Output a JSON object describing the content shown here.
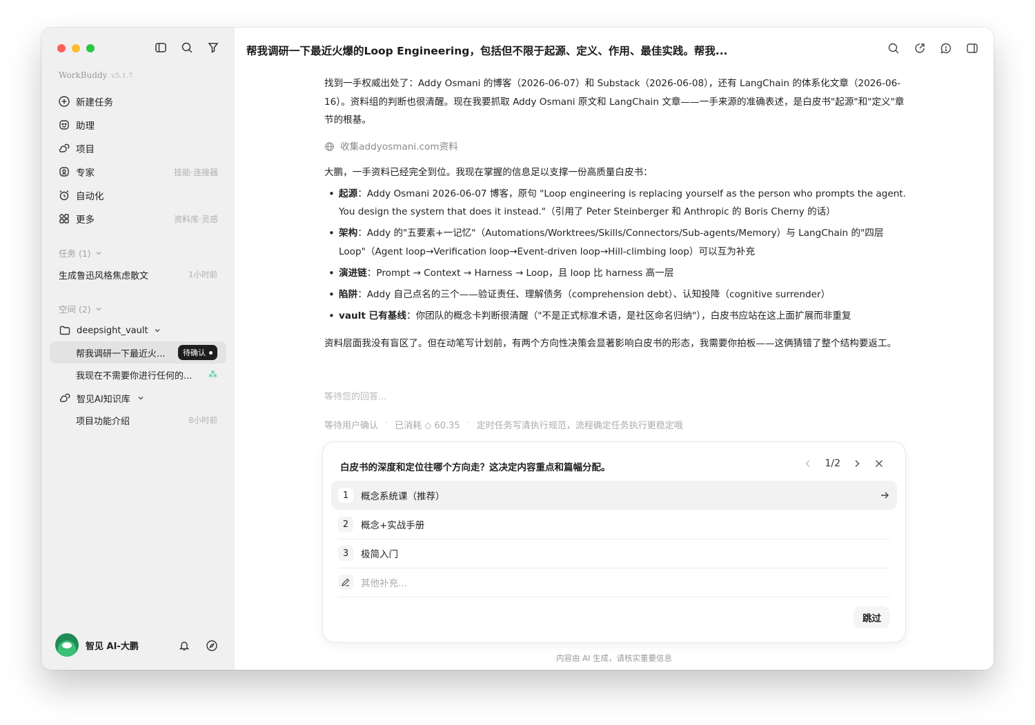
{
  "app": {
    "name": "WorkBuddy",
    "version": "v5.1.7"
  },
  "sidebar": {
    "nav": [
      {
        "label": "新建任务",
        "hint": "",
        "icon": "plus-circle-icon"
      },
      {
        "label": "助理",
        "hint": "",
        "icon": "assistant-icon"
      },
      {
        "label": "项目",
        "hint": "",
        "icon": "project-icon"
      },
      {
        "label": "专家",
        "hint": "技能·连接器",
        "icon": "expert-icon"
      },
      {
        "label": "自动化",
        "hint": "",
        "icon": "alarm-clock-icon"
      },
      {
        "label": "更多",
        "hint": "资料库·灵感",
        "icon": "grid-icon"
      }
    ],
    "tasks_header": "任务 (1)",
    "tasks": [
      {
        "title": "生成鲁迅风格焦虑散文",
        "time": "1小时前"
      }
    ],
    "spaces_header": "空间 (2)",
    "spaces": [
      {
        "name": "deepsight_vault",
        "items": [
          {
            "title": "帮我调研一下最近火...",
            "badge": "待确认"
          },
          {
            "title": "我现在不需要你进行任何的..."
          }
        ]
      },
      {
        "name": "智见AI知识库",
        "items": [
          {
            "title": "项目功能介绍",
            "time": "8小时前"
          }
        ]
      }
    ],
    "user": {
      "name": "智见 AI-大鹏"
    }
  },
  "main": {
    "title": "帮我调研一下最近火爆的Loop Engineering，包括但不限于起源、定义、作用、最佳实践。帮我...",
    "para1": "找到一手权威出处了：Addy Osmani 的博客（2026-06-07）和 Substack（2026-06-08），还有 LangChain 的体系化文章（2026-06-16）。资料组的判断也很清醒。现在我要抓取 Addy Osmani 原文和 LangChain 文章——一手来源的准确表述，是白皮书\"起源\"和\"定义\"章节的根基。",
    "tool_call": "收集addyosmani.com资料",
    "para2": "大鹏，一手资料已经完全到位。我现在掌握的信息足以支撑一份高质量白皮书：",
    "bullets": [
      {
        "label": "起源",
        "text": "：Addy Osmani 2026-06-07 博客，原句 \"Loop engineering is replacing yourself as the person who prompts the agent. You design the system that does it instead.\"（引用了 Peter Steinberger 和 Anthropic 的 Boris Cherny 的话）"
      },
      {
        "label": "架构",
        "text": "：Addy 的\"五要素+一记忆\"（Automations/Worktrees/Skills/Connectors/Sub-agents/Memory）与 LangChain 的\"四层 Loop\"（Agent loop→Verification loop→Event-driven loop→Hill-climbing loop）可以互为补充"
      },
      {
        "label": "演进链",
        "text": "：Prompt → Context → Harness → Loop，且 loop 比 harness 高一层"
      },
      {
        "label": "陷阱",
        "text": "：Addy 自己点名的三个——验证责任、理解债务（comprehension debt）、认知投降（cognitive surrender）"
      },
      {
        "label": "vault 已有基线",
        "text": "：你团队的概念卡判断很清醒（\"不是正式标准术语，是社区命名归纳\"），白皮书应站在这上面扩展而非重复"
      }
    ],
    "para3": "资料层面我没有盲区了。但在动笔写计划前，有两个方向性决策会显著影响白皮书的形态，我需要你拍板——这俩猜错了整个结构要返工。",
    "waiting": "等待您的回答...",
    "status": {
      "state": "等待用户确认",
      "cost": "已消耗 ◇ 60.35",
      "tip": "定时任务写清执行规范，流程确定任务执行更稳定哦"
    },
    "question": {
      "text": "白皮书的深度和定位往哪个方向走？这决定内容重点和篇幅分配。",
      "page": "1/2",
      "options": [
        {
          "num": "1",
          "label": "概念系统课（推荐）"
        },
        {
          "num": "2",
          "label": "概念+实战手册"
        },
        {
          "num": "3",
          "label": "极简入门"
        }
      ],
      "other_placeholder": "其他补充...",
      "skip": "跳过"
    },
    "footer": "内容由 AI 生成，请核实重要信息"
  }
}
